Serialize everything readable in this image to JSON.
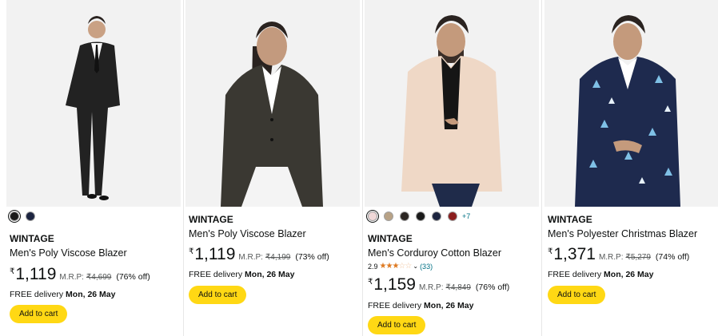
{
  "products": [
    {
      "brand": "WINTAGE",
      "title": "Men's Poly Viscose Blazer",
      "currency": "₹",
      "price": "1,119",
      "mrp_label": "M.R.P:",
      "mrp": "₹4,699",
      "discount": "(76% off)",
      "delivery_label": "FREE delivery",
      "delivery_date": "Mon, 26 May",
      "button": "Add to cart",
      "swatches": [
        "#1a1a1a",
        "#1c2440"
      ],
      "image": "man-in-black-suit-image"
    },
    {
      "brand": "WINTAGE",
      "title": "Men's Poly Viscose Blazer",
      "currency": "₹",
      "price": "1,119",
      "mrp_label": "M.R.P:",
      "mrp": "₹4,199",
      "discount": "(73% off)",
      "delivery_label": "FREE delivery",
      "delivery_date": "Mon, 26 May",
      "button": "Add to cart",
      "image": "man-in-dark-grey-blazer-image"
    },
    {
      "brand": "WINTAGE",
      "title": "Men's Corduroy Cotton Blazer",
      "rating": "2.9",
      "rating_count": "(33)",
      "currency": "₹",
      "price": "1,159",
      "mrp_label": "M.R.P:",
      "mrp": "₹4,849",
      "discount": "(76% off)",
      "delivery_label": "FREE delivery",
      "delivery_date": "Mon, 26 May",
      "button": "Add to cart",
      "swatches": [
        "#f0d8d8",
        "#b8a286",
        "#2b2522",
        "#1a1a1a",
        "#1c2440",
        "#8b1d1d"
      ],
      "more_colors": "+7",
      "image": "man-in-beige-blazer-image"
    },
    {
      "brand": "WINTAGE",
      "title": "Men's Polyester Christmas Blazer",
      "currency": "₹",
      "price": "1,371",
      "mrp_label": "M.R.P:",
      "mrp": "₹5,279",
      "discount": "(74% off)",
      "delivery_label": "FREE delivery",
      "delivery_date": "Mon, 26 May",
      "button": "Add to cart",
      "image": "man-in-christmas-print-blazer-image"
    }
  ],
  "colors": {
    "button": "#ffd814",
    "link": "#007185",
    "star": "#de7921"
  }
}
